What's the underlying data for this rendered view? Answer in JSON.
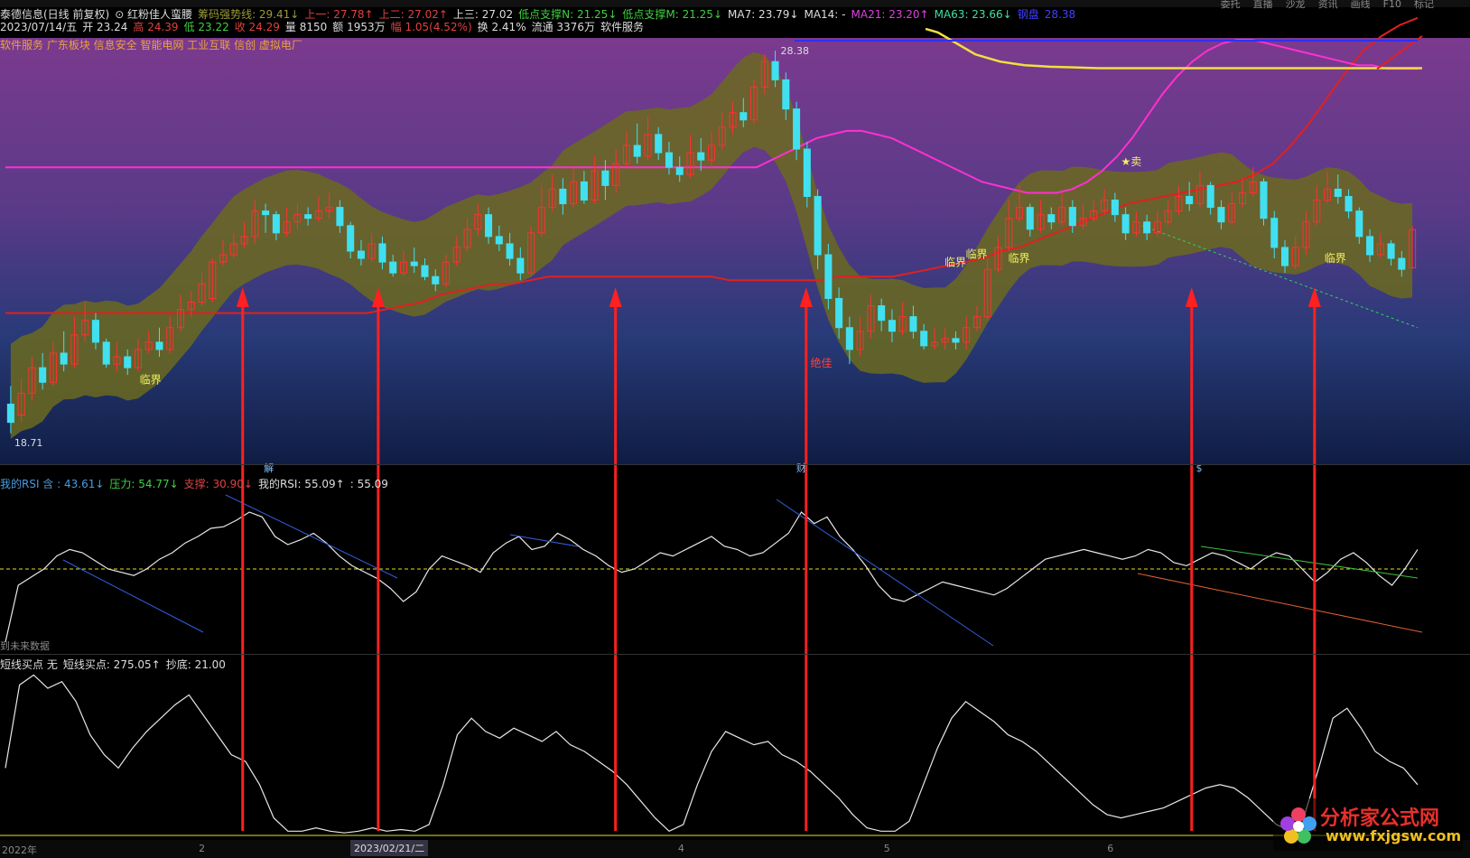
{
  "header": {
    "line1": [
      {
        "text": "泰德信息(日线 前复权)",
        "color": "#dddddd"
      },
      {
        "text": "⊙ 红粉佳人蛮腰",
        "color": "#dddddd"
      },
      {
        "text": "筹码强势线: 29.41↓",
        "color": "#9a9a3a"
      },
      {
        "text": "上一: 27.78↑",
        "color": "#e04040"
      },
      {
        "text": "上二: 27.02↑",
        "color": "#e04040"
      },
      {
        "text": "上三: 27.02",
        "color": "#dddddd"
      },
      {
        "text": "低点支撑N: 21.25↓",
        "color": "#40d040"
      },
      {
        "text": "低点支撑M: 21.25↓",
        "color": "#40d040"
      },
      {
        "text": "MA7: 23.79↓",
        "color": "#dddddd"
      },
      {
        "text": "MA14: -",
        "color": "#dddddd"
      },
      {
        "text": "MA21: 23.20↑",
        "color": "#e040e0"
      },
      {
        "text": "MA63: 23.66↓",
        "color": "#40e0a0"
      },
      {
        "text": "钢盘",
        "color": "#4040ff"
      },
      {
        "text": "28.38",
        "color": "#4040ff"
      }
    ],
    "line2": [
      {
        "text": "2023/07/14/五",
        "color": "#dddddd"
      },
      {
        "text": "开 23.24",
        "color": "#dddddd"
      },
      {
        "text": "高 24.39",
        "color": "#e04040"
      },
      {
        "text": "低 23.22",
        "color": "#40d040"
      },
      {
        "text": "收 24.29",
        "color": "#e04040"
      },
      {
        "text": "量 8150",
        "color": "#dddddd"
      },
      {
        "text": "额 1953万",
        "color": "#dddddd"
      },
      {
        "text": "幅 1.05(4.52%)",
        "color": "#e04040"
      },
      {
        "text": "换 2.41%",
        "color": "#dddddd"
      },
      {
        "text": "流通 3376万",
        "color": "#dddddd"
      },
      {
        "text": "软件服务",
        "color": "#dddddd"
      }
    ],
    "sectors": "软件服务 广东板块 信息安全 智能电网 工业互联 信创 虚拟电厂",
    "menu": [
      "委托",
      "直播",
      "沙龙",
      "资讯",
      "画线",
      "F10",
      "标记"
    ]
  },
  "rsi_legend": [
    {
      "text": "我的RSI 含 : 43.61↓",
      "color": "#4a9ae0"
    },
    {
      "text": "压力: 54.77↓",
      "color": "#40d040"
    },
    {
      "text": "支撑: 30.90↓",
      "color": "#e04040"
    },
    {
      "text": "我的RSI: 55.09↑",
      "color": "#dddddd"
    },
    {
      "text": ": 55.09",
      "color": "#dddddd"
    }
  ],
  "stl_legend": [
    {
      "text": "短线买点 无",
      "color": "#dddddd"
    },
    {
      "text": "短线买点: 275.05↑",
      "color": "#dddddd"
    },
    {
      "text": "抄底: 21.00",
      "color": "#dddddd"
    }
  ],
  "axis": {
    "ticks": [
      {
        "label": "2022年",
        "pos": 0.0
      },
      {
        "label": "2",
        "pos": 0.134
      },
      {
        "label": "4",
        "pos": 0.46
      },
      {
        "label": "5",
        "pos": 0.6
      },
      {
        "label": "6",
        "pos": 0.752
      }
    ],
    "scroll_date": "2023/02/21/二"
  },
  "future_label": "到未来数据",
  "logo": {
    "title": "分析家公式网",
    "url": "www.fxjgsw.com"
  },
  "colors": {
    "up": "#ff3030",
    "down": "#40e0f0",
    "band": "#6b6a1e",
    "ma_red": "#e02020",
    "ma_pink": "#ff30d0",
    "ma_yellow": "#f0e040",
    "arrow": "#ff2020"
  },
  "chart_data": {
    "type": "candlestick",
    "price_range": [
      18.0,
      29.5
    ],
    "low_label": "18.71",
    "high_label": "28.38",
    "candles": [
      [
        19.5,
        19.0,
        20.0,
        18.7
      ],
      [
        19.2,
        19.8,
        20.2,
        19.0
      ],
      [
        19.8,
        20.5,
        20.8,
        19.6
      ],
      [
        20.5,
        20.1,
        20.9,
        19.9
      ],
      [
        20.1,
        20.9,
        21.2,
        20.0
      ],
      [
        20.9,
        20.6,
        21.5,
        20.4
      ],
      [
        20.6,
        21.4,
        21.9,
        20.5
      ],
      [
        21.4,
        21.8,
        22.3,
        21.2
      ],
      [
        21.8,
        21.2,
        22.0,
        21.0
      ],
      [
        21.2,
        20.6,
        21.3,
        20.5
      ],
      [
        20.6,
        20.8,
        21.2,
        20.4
      ],
      [
        20.8,
        20.5,
        21.0,
        20.3
      ],
      [
        20.5,
        21.0,
        21.3,
        20.4
      ],
      [
        21.0,
        21.2,
        21.5,
        20.9
      ],
      [
        21.2,
        21.0,
        21.6,
        20.8
      ],
      [
        21.0,
        21.6,
        21.9,
        20.9
      ],
      [
        21.6,
        22.1,
        22.5,
        21.5
      ],
      [
        22.1,
        22.3,
        22.6,
        21.9
      ],
      [
        22.3,
        22.8,
        23.1,
        22.2
      ],
      [
        22.4,
        23.4,
        23.5,
        22.3
      ],
      [
        23.4,
        23.6,
        24.0,
        23.3
      ],
      [
        23.6,
        23.9,
        24.2,
        23.5
      ],
      [
        23.9,
        24.1,
        24.5,
        23.8
      ],
      [
        24.1,
        24.8,
        25.1,
        23.9
      ],
      [
        24.8,
        24.7,
        25.0,
        24.2
      ],
      [
        24.7,
        24.2,
        24.8,
        24.0
      ],
      [
        24.2,
        24.5,
        24.9,
        24.1
      ],
      [
        24.5,
        24.7,
        25.0,
        24.3
      ],
      [
        24.7,
        24.6,
        24.9,
        24.4
      ],
      [
        24.6,
        24.8,
        25.2,
        24.5
      ],
      [
        24.8,
        24.9,
        25.3,
        24.6
      ],
      [
        24.9,
        24.4,
        25.1,
        24.2
      ],
      [
        24.4,
        23.7,
        24.5,
        23.5
      ],
      [
        23.7,
        23.5,
        24.0,
        23.3
      ],
      [
        23.5,
        23.9,
        24.2,
        23.4
      ],
      [
        23.9,
        23.4,
        24.1,
        23.2
      ],
      [
        23.4,
        23.1,
        23.6,
        23.0
      ],
      [
        23.1,
        23.4,
        23.7,
        23.0
      ],
      [
        23.4,
        23.3,
        23.8,
        23.1
      ],
      [
        23.3,
        23.0,
        23.5,
        22.9
      ],
      [
        23.0,
        22.8,
        23.2,
        22.6
      ],
      [
        22.8,
        23.4,
        23.6,
        22.7
      ],
      [
        23.4,
        23.8,
        24.1,
        23.3
      ],
      [
        23.8,
        24.3,
        24.6,
        23.7
      ],
      [
        24.3,
        24.7,
        25.0,
        24.1
      ],
      [
        24.7,
        24.1,
        24.9,
        23.9
      ],
      [
        24.1,
        23.9,
        24.4,
        23.7
      ],
      [
        23.9,
        23.5,
        24.2,
        23.3
      ],
      [
        23.5,
        23.1,
        23.8,
        22.9
      ],
      [
        23.1,
        24.2,
        24.4,
        23.0
      ],
      [
        24.2,
        24.9,
        25.5,
        24.1
      ],
      [
        24.9,
        25.4,
        25.8,
        24.8
      ],
      [
        25.4,
        25.0,
        25.7,
        24.7
      ],
      [
        25.0,
        25.6,
        26.0,
        24.9
      ],
      [
        25.6,
        25.1,
        25.9,
        25.0
      ],
      [
        25.1,
        25.9,
        26.3,
        25.0
      ],
      [
        25.9,
        25.5,
        26.2,
        25.1
      ],
      [
        25.5,
        26.1,
        26.5,
        25.3
      ],
      [
        26.1,
        26.6,
        27.0,
        26.0
      ],
      [
        26.6,
        26.3,
        27.2,
        26.1
      ],
      [
        26.3,
        26.9,
        27.4,
        26.2
      ],
      [
        26.9,
        26.4,
        27.1,
        26.2
      ],
      [
        26.4,
        26.0,
        26.7,
        25.8
      ],
      [
        26.0,
        25.8,
        26.3,
        25.6
      ],
      [
        25.8,
        26.4,
        26.9,
        25.7
      ],
      [
        26.4,
        26.2,
        26.8,
        25.9
      ],
      [
        26.2,
        26.6,
        27.0,
        26.0
      ],
      [
        26.6,
        27.1,
        27.5,
        26.5
      ],
      [
        27.1,
        27.5,
        27.8,
        26.9
      ],
      [
        27.5,
        27.3,
        27.9,
        27.1
      ],
      [
        27.3,
        28.2,
        28.4,
        27.2
      ],
      [
        28.2,
        28.9,
        29.1,
        28.0
      ],
      [
        28.9,
        28.4,
        29.2,
        28.2
      ],
      [
        28.4,
        27.6,
        28.6,
        27.3
      ],
      [
        27.6,
        26.5,
        27.8,
        26.2
      ],
      [
        26.5,
        25.2,
        26.7,
        24.9
      ],
      [
        25.2,
        23.6,
        25.4,
        23.2
      ],
      [
        23.6,
        22.4,
        23.9,
        22.1
      ],
      [
        22.4,
        21.6,
        22.7,
        21.3
      ],
      [
        21.6,
        21.0,
        21.9,
        20.6
      ],
      [
        21.0,
        21.5,
        21.9,
        20.8
      ],
      [
        21.5,
        22.2,
        22.5,
        21.3
      ],
      [
        22.2,
        21.8,
        22.4,
        21.5
      ],
      [
        21.8,
        21.5,
        22.1,
        21.2
      ],
      [
        21.5,
        21.9,
        22.3,
        21.4
      ],
      [
        21.9,
        21.5,
        22.2,
        21.3
      ],
      [
        21.5,
        21.1,
        21.7,
        21.0
      ],
      [
        21.1,
        21.2,
        21.6,
        21.0
      ],
      [
        21.2,
        21.3,
        21.6,
        21.0
      ],
      [
        21.3,
        21.2,
        21.5,
        21.0
      ],
      [
        21.2,
        21.6,
        21.9,
        21.0
      ],
      [
        21.6,
        21.9,
        22.2,
        21.5
      ],
      [
        21.9,
        23.2,
        23.5,
        21.8
      ],
      [
        23.2,
        23.8,
        24.1,
        23.1
      ],
      [
        23.8,
        24.6,
        25.1,
        23.7
      ],
      [
        24.6,
        24.9,
        25.5,
        24.5
      ],
      [
        24.9,
        24.3,
        25.0,
        24.1
      ],
      [
        24.3,
        24.7,
        25.1,
        24.2
      ],
      [
        24.7,
        24.5,
        24.9,
        24.3
      ],
      [
        24.5,
        24.9,
        25.3,
        24.4
      ],
      [
        24.9,
        24.4,
        25.1,
        24.2
      ],
      [
        24.4,
        24.6,
        25.0,
        24.3
      ],
      [
        24.6,
        24.8,
        25.1,
        24.5
      ],
      [
        24.8,
        25.1,
        25.4,
        24.7
      ],
      [
        25.1,
        24.7,
        25.3,
        24.5
      ],
      [
        24.7,
        24.2,
        24.9,
        24.0
      ],
      [
        24.2,
        24.5,
        24.8,
        24.1
      ],
      [
        24.5,
        24.2,
        24.7,
        24.0
      ],
      [
        24.2,
        24.5,
        24.8,
        24.1
      ],
      [
        24.5,
        24.8,
        25.1,
        24.4
      ],
      [
        24.8,
        25.2,
        25.5,
        24.7
      ],
      [
        25.2,
        25.0,
        25.6,
        24.8
      ],
      [
        25.0,
        25.5,
        25.9,
        24.9
      ],
      [
        25.5,
        24.9,
        25.6,
        24.7
      ],
      [
        24.9,
        24.5,
        25.1,
        24.3
      ],
      [
        24.5,
        25.0,
        25.3,
        24.4
      ],
      [
        25.0,
        25.3,
        25.7,
        24.9
      ],
      [
        25.3,
        25.6,
        26.0,
        25.2
      ],
      [
        25.6,
        24.6,
        25.7,
        24.4
      ],
      [
        24.6,
        23.8,
        24.8,
        23.5
      ],
      [
        23.8,
        23.3,
        24.0,
        23.1
      ],
      [
        23.3,
        23.8,
        24.1,
        23.2
      ],
      [
        23.8,
        24.5,
        24.8,
        23.6
      ],
      [
        24.5,
        25.1,
        25.5,
        24.4
      ],
      [
        25.1,
        25.4,
        25.9,
        25.0
      ],
      [
        25.4,
        25.2,
        25.8,
        25.0
      ],
      [
        25.2,
        24.8,
        25.4,
        24.6
      ],
      [
        24.8,
        24.1,
        24.9,
        23.9
      ],
      [
        24.1,
        23.6,
        24.3,
        23.4
      ],
      [
        23.6,
        23.9,
        24.2,
        23.5
      ],
      [
        23.9,
        23.5,
        24.0,
        23.3
      ],
      [
        23.5,
        23.2,
        23.7,
        23.0
      ],
      [
        23.24,
        24.29,
        24.39,
        23.22
      ]
    ],
    "ma_red": [
      22.0,
      22.0,
      22.0,
      22.0,
      22.0,
      22.0,
      22.0,
      22.0,
      22.0,
      22.0,
      22.0,
      22.0,
      22.0,
      22.0,
      22.0,
      22.0,
      22.0,
      22.0,
      22.0,
      22.0,
      22.0,
      22.1,
      22.2,
      22.3,
      22.5,
      22.6,
      22.7,
      22.8,
      22.8,
      22.9,
      23.0,
      23.0,
      23.0,
      23.0,
      23.0,
      23.0,
      23.0,
      23.0,
      23.0,
      23.0,
      22.9,
      22.9,
      22.9,
      22.9,
      22.9,
      22.9,
      23.0,
      23.0,
      23.0,
      23.0,
      23.1,
      23.2,
      23.3,
      23.4,
      23.5,
      23.7,
      23.8,
      24.0,
      24.2,
      24.4,
      24.6,
      24.8,
      25.0,
      25.1,
      25.2,
      25.3,
      25.4,
      25.5,
      25.6,
      25.8,
      26.1,
      26.6,
      27.2,
      27.9,
      28.6,
      29.2,
      29.6,
      29.9,
      30.1
    ],
    "ma_pink": [
      26.0,
      26.0,
      26.0,
      26.0,
      26.0,
      26.0,
      26.0,
      26.0,
      26.0,
      26.0,
      26.0,
      26.0,
      26.0,
      26.0,
      26.0,
      26.0,
      26.0,
      26.0,
      26.0,
      26.0,
      26.0,
      26.0,
      26.0,
      26.0,
      26.0,
      26.0,
      26.0,
      26.0,
      26.0,
      26.0,
      26.0,
      26.0,
      26.0,
      26.0,
      26.0,
      26.0,
      26.0,
      26.0,
      26.0,
      26.0,
      26.0,
      26.0,
      26.0,
      26.0,
      26.0,
      26.0,
      26.0,
      26.0,
      26.0,
      26.0,
      26.0,
      26.2,
      26.4,
      26.6,
      26.8,
      26.9,
      27.0,
      27.0,
      26.9,
      26.8,
      26.6,
      26.4,
      26.2,
      26.0,
      25.8,
      25.6,
      25.5,
      25.4,
      25.3,
      25.3,
      25.3,
      25.4,
      25.6,
      25.9,
      26.3,
      26.8,
      27.4,
      28.0,
      28.5,
      28.9,
      29.2,
      29.4,
      29.5,
      29.5,
      29.4,
      29.3,
      29.2,
      29.1,
      29.0,
      28.9,
      28.8,
      28.8,
      28.7,
      28.7,
      28.7
    ],
    "ma_yellow": [
      29.8,
      29.7,
      29.5,
      29.3,
      29.1,
      29.0,
      28.9,
      28.85,
      28.8,
      28.78,
      28.76,
      28.75,
      28.74,
      28.73,
      28.72,
      28.72,
      28.72,
      28.72,
      28.72,
      28.72,
      28.72,
      28.72,
      28.72,
      28.72,
      28.72,
      28.72,
      28.72,
      28.72,
      28.72,
      28.72,
      28.72,
      28.72,
      28.72,
      28.72,
      28.72,
      28.72,
      28.72,
      28.72,
      28.72,
      28.72,
      28.72
    ],
    "rsi": [
      5,
      40,
      45,
      50,
      58,
      62,
      60,
      55,
      50,
      48,
      46,
      50,
      56,
      60,
      66,
      70,
      75,
      76,
      80,
      85,
      82,
      70,
      65,
      68,
      72,
      66,
      58,
      52,
      48,
      44,
      38,
      30,
      36,
      50,
      58,
      55,
      52,
      48,
      60,
      66,
      70,
      62,
      64,
      72,
      68,
      62,
      58,
      52,
      48,
      50,
      55,
      60,
      58,
      62,
      66,
      70,
      64,
      62,
      58,
      60,
      66,
      72,
      85,
      78,
      82,
      70,
      62,
      52,
      40,
      32,
      30,
      34,
      38,
      42,
      40,
      38,
      36,
      34,
      38,
      44,
      50,
      56,
      58,
      60,
      62,
      60,
      58,
      56,
      58,
      62,
      60,
      54,
      52,
      56,
      60,
      58,
      54,
      50,
      56,
      60,
      58,
      50,
      42,
      48,
      56,
      60,
      54,
      46,
      40,
      50,
      62
    ],
    "stl": [
      40,
      90,
      96,
      88,
      92,
      80,
      60,
      48,
      40,
      52,
      62,
      70,
      78,
      84,
      72,
      60,
      48,
      44,
      30,
      10,
      2,
      2,
      4,
      2,
      1,
      2,
      4,
      2,
      3,
      2,
      6,
      30,
      60,
      70,
      62,
      58,
      64,
      60,
      56,
      62,
      54,
      50,
      44,
      38,
      30,
      20,
      10,
      2,
      6,
      30,
      50,
      62,
      58,
      54,
      56,
      48,
      44,
      38,
      30,
      22,
      12,
      4,
      2,
      2,
      8,
      30,
      52,
      70,
      80,
      74,
      68,
      60,
      56,
      50,
      42,
      34,
      26,
      18,
      12,
      10,
      12,
      14,
      16,
      20,
      24,
      28,
      30,
      28,
      22,
      14,
      6,
      2,
      12,
      40,
      70,
      76,
      64,
      50,
      44,
      40,
      30
    ],
    "arrows": [
      0.168,
      0.264,
      0.432,
      0.567,
      0.84,
      0.927
    ],
    "labels": [
      {
        "text": "临界",
        "x": 0.095,
        "y": 0.82
      },
      {
        "text": "临界",
        "x": 0.665,
        "y": 0.54
      },
      {
        "text": "临界",
        "x": 0.68,
        "y": 0.52
      },
      {
        "text": "临界",
        "x": 0.71,
        "y": 0.53
      },
      {
        "text": "临界",
        "x": 0.934,
        "y": 0.53
      },
      {
        "text": "★卖",
        "x": 0.79,
        "y": 0.3
      },
      {
        "text": "绝佳",
        "x": 0.57,
        "y": 0.78
      }
    ],
    "markers": [
      {
        "text": "解",
        "x": 0.183
      },
      {
        "text": "财",
        "x": 0.56
      },
      {
        "text": "$",
        "x": 0.843
      }
    ]
  }
}
